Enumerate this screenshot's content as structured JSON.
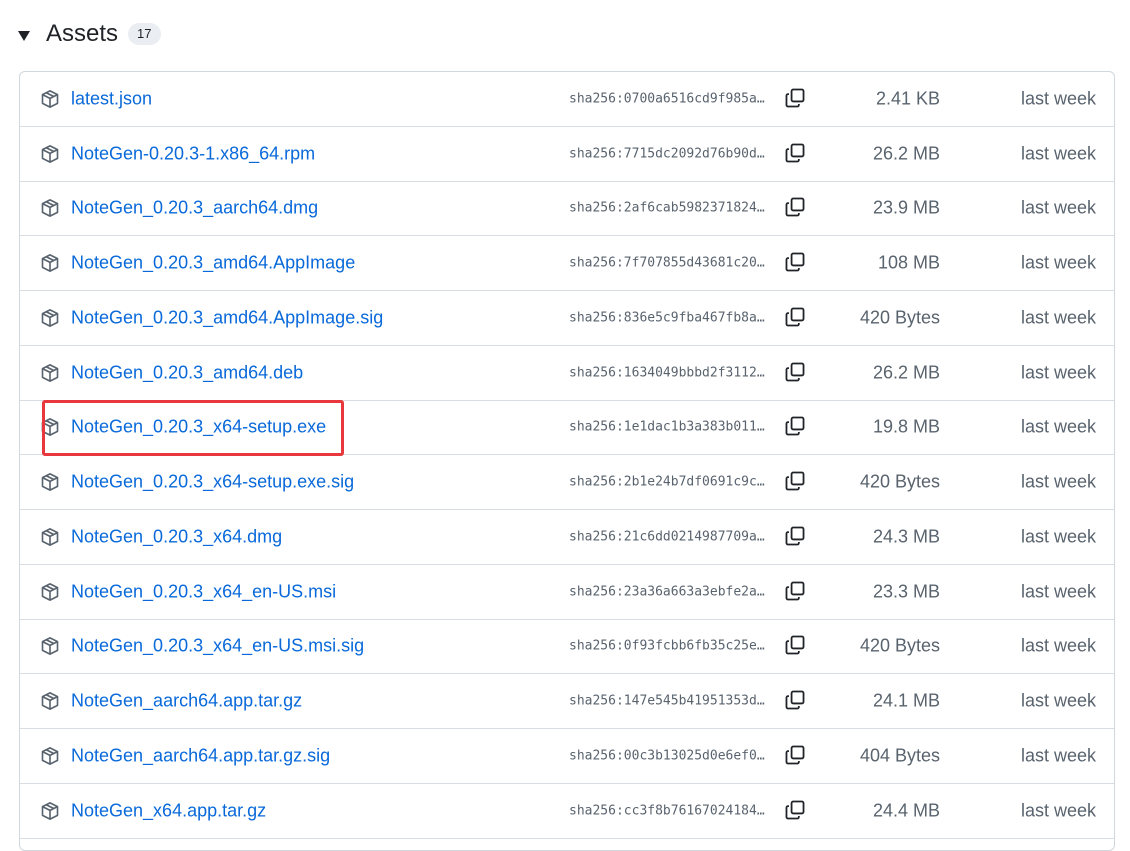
{
  "header": {
    "title": "Assets",
    "count": "17"
  },
  "assets": [
    {
      "name": "latest.json",
      "sha": "sha256:0700a6516cd9f985a…",
      "size": "2.41 KB",
      "date": "last week"
    },
    {
      "name": "NoteGen-0.20.3-1.x86_64.rpm",
      "sha": "sha256:7715dc2092d76b90d…",
      "size": "26.2 MB",
      "date": "last week"
    },
    {
      "name": "NoteGen_0.20.3_aarch64.dmg",
      "sha": "sha256:2af6cab5982371824…",
      "size": "23.9 MB",
      "date": "last week"
    },
    {
      "name": "NoteGen_0.20.3_amd64.AppImage",
      "sha": "sha256:7f707855d43681c20…",
      "size": "108 MB",
      "date": "last week"
    },
    {
      "name": "NoteGen_0.20.3_amd64.AppImage.sig",
      "sha": "sha256:836e5c9fba467fb8a…",
      "size": "420 Bytes",
      "date": "last week"
    },
    {
      "name": "NoteGen_0.20.3_amd64.deb",
      "sha": "sha256:1634049bbbd2f3112…",
      "size": "26.2 MB",
      "date": "last week"
    },
    {
      "name": "NoteGen_0.20.3_x64-setup.exe",
      "sha": "sha256:1e1dac1b3a383b011…",
      "size": "19.8 MB",
      "date": "last week"
    },
    {
      "name": "NoteGen_0.20.3_x64-setup.exe.sig",
      "sha": "sha256:2b1e24b7df0691c9c…",
      "size": "420 Bytes",
      "date": "last week"
    },
    {
      "name": "NoteGen_0.20.3_x64.dmg",
      "sha": "sha256:21c6dd0214987709a…",
      "size": "24.3 MB",
      "date": "last week"
    },
    {
      "name": "NoteGen_0.20.3_x64_en-US.msi",
      "sha": "sha256:23a36a663a3ebfe2a…",
      "size": "23.3 MB",
      "date": "last week"
    },
    {
      "name": "NoteGen_0.20.3_x64_en-US.msi.sig",
      "sha": "sha256:0f93fcbb6fb35c25e…",
      "size": "420 Bytes",
      "date": "last week"
    },
    {
      "name": "NoteGen_aarch64.app.tar.gz",
      "sha": "sha256:147e545b41951353d…",
      "size": "24.1 MB",
      "date": "last week"
    },
    {
      "name": "NoteGen_aarch64.app.tar.gz.sig",
      "sha": "sha256:00c3b13025d0e6ef0…",
      "size": "404 Bytes",
      "date": "last week"
    },
    {
      "name": "NoteGen_x64.app.tar.gz",
      "sha": "sha256:cc3f8b76167024184…",
      "size": "24.4 MB",
      "date": "last week"
    }
  ],
  "icons": {
    "row_icon": "package-icon",
    "copy_icon": "copy-icon",
    "toggle_icon": "triangle-down-icon"
  },
  "colors": {
    "link": "#0969da",
    "muted": "#59636e",
    "border": "#d0d7de",
    "highlight": "#e8383d"
  }
}
